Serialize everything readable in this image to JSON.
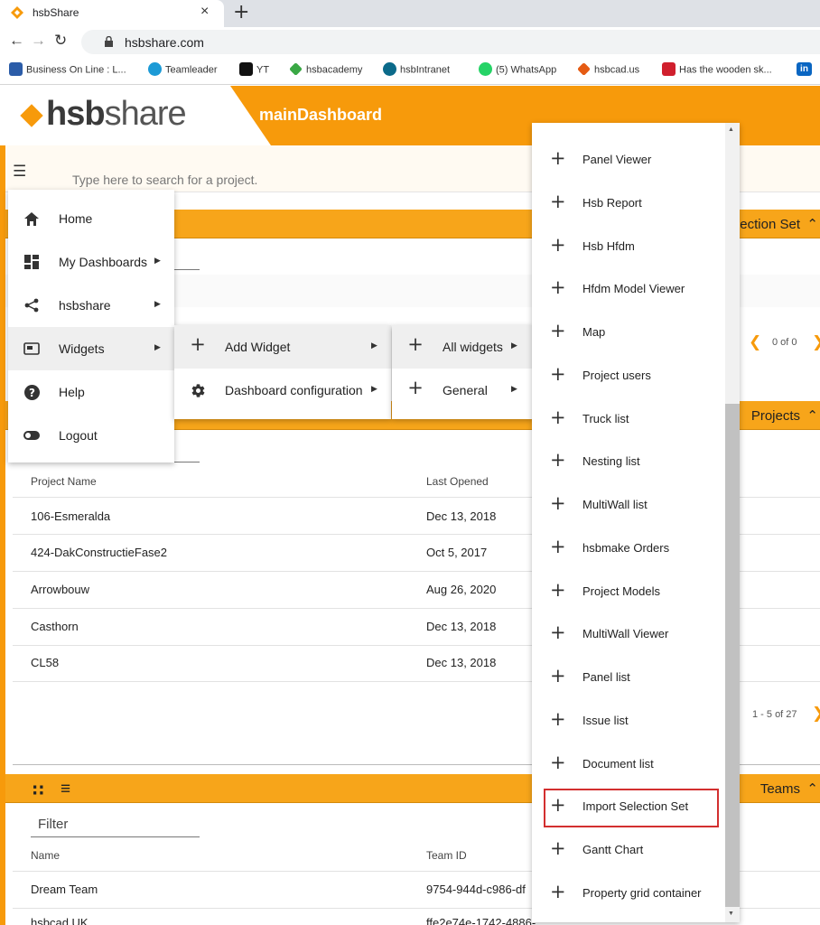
{
  "browser": {
    "tab_title": "hsbShare",
    "tab_close": "×",
    "new_tab": "+",
    "url": "hsbshare.com",
    "bookmarks": [
      {
        "label": "Business On Line : L...",
        "color": "#2b5ca8"
      },
      {
        "label": "Teamleader",
        "color": "#1c9ad6"
      },
      {
        "label": "YT",
        "color": "#111111"
      },
      {
        "label": "hsbacademy",
        "color": "#3aa845"
      },
      {
        "label": "hsbIntranet",
        "color": "#0b6a8a"
      },
      {
        "label": "(5) WhatsApp",
        "color": "#25d366"
      },
      {
        "label": "hsbcad.us",
        "color": "#e55b13"
      },
      {
        "label": "Has the wooden sk...",
        "color": "#d01f2d"
      },
      {
        "label": "in",
        "color": "#0a66c2"
      }
    ]
  },
  "app": {
    "logo_bold": "hsb",
    "logo_light": "share",
    "title": "mainDashboard",
    "accent_color": "#f79a0b"
  },
  "search": {
    "placeholder": "Type here to search for a project."
  },
  "panels": {
    "selection_set_title": "lection Set",
    "projects_title": "Projects",
    "teams_title": "Teams",
    "selection_pager": "0 of 0",
    "projects_pager": "1 - 5 of 27"
  },
  "projects_table": {
    "columns": [
      "Project Name",
      "Last Opened"
    ],
    "rows": [
      [
        "106-Esmeralda",
        "Dec 13, 2018"
      ],
      [
        "424-DakConstructieFase2",
        "Oct 5, 2017"
      ],
      [
        "Arrowbouw",
        "Aug 26, 2020"
      ],
      [
        "Casthorn",
        "Dec 13, 2018"
      ],
      [
        "CL58",
        "Dec 13, 2018"
      ]
    ]
  },
  "teams_table": {
    "filter_label": "Filter",
    "columns": [
      "Name",
      "Team ID"
    ],
    "rows": [
      [
        "Dream Team",
        "9754-944d-c986-df"
      ],
      [
        "hsbcad UK",
        "ffe2e74e-1742-4886-"
      ]
    ]
  },
  "main_menu": {
    "items": [
      {
        "label": "Home",
        "icon": "home-icon"
      },
      {
        "label": "My Dashboards",
        "icon": "dashboard-icon"
      },
      {
        "label": "hsbshare",
        "icon": "share-icon"
      },
      {
        "label": "Widgets",
        "icon": "widgets-icon"
      },
      {
        "label": "Help",
        "icon": "help-icon"
      },
      {
        "label": "Logout",
        "icon": "toggle-icon"
      }
    ]
  },
  "widgets_menu": {
    "items": [
      {
        "label": "Add Widget",
        "icon": "plus-icon"
      },
      {
        "label": "Dashboard configuration",
        "icon": "gear-icon"
      }
    ]
  },
  "add_widget_menu": {
    "items": [
      {
        "label": "All widgets"
      },
      {
        "label": "General"
      }
    ]
  },
  "all_widgets_menu": {
    "items": [
      "Panel Viewer",
      "Hsb Report",
      "Hsb Hfdm",
      "Hfdm Model Viewer",
      "Map",
      "Project users",
      "Truck list",
      "Nesting list",
      "MultiWall list",
      "hsbmake Orders",
      "Project Models",
      "MultiWall Viewer",
      "Panel list",
      "Issue list",
      "Document list",
      "Import Selection Set",
      "Gantt Chart",
      "Property grid container"
    ],
    "highlighted": "Import Selection Set",
    "highlight_color": "#d32f2f"
  }
}
